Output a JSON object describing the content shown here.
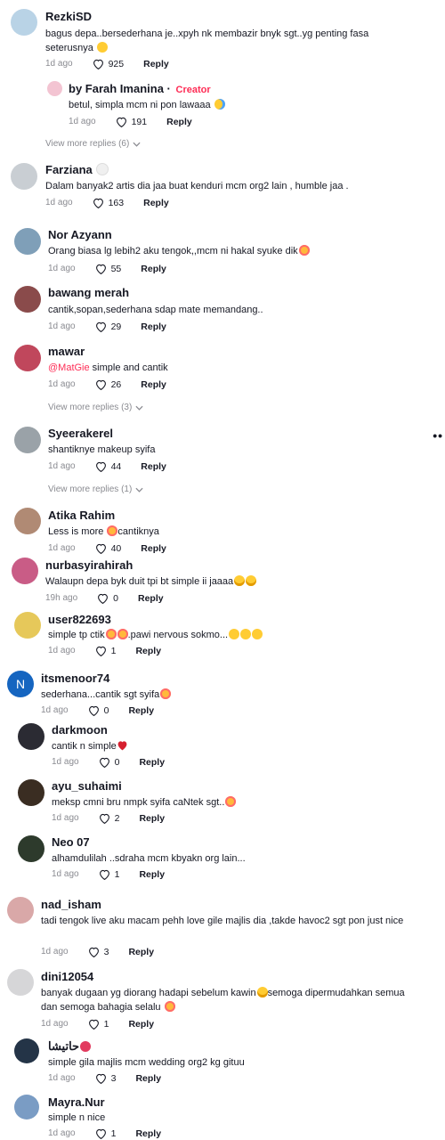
{
  "comments": [
    {
      "user": "RezkiSD",
      "text": "bagus depa..bersederhana je..xpyh nk membazir bnyk sgt..yg penting fasa seterusnya",
      "emoji": "smile",
      "time": "1d ago",
      "likes": "925",
      "reply": "Reply",
      "avatar_color": "#b9d3e6"
    },
    {
      "user": "by Farah Imanina",
      "creator_sep": "·",
      "creator": "Creator",
      "text": "betul, simpla mcm ni pon lawaaa",
      "emoji": "cry",
      "time": "1d ago",
      "likes": "191",
      "reply": "Reply",
      "avatar_color": "#f3c4d2"
    },
    {
      "view_more": "View more replies (6)"
    },
    {
      "user": "Farziana",
      "user_emoji": "white-heart",
      "text": "Dalam banyak2 artis dia jaa buat kenduri mcm org2 lain , humble jaa .",
      "time": "1d ago",
      "likes": "163",
      "reply": "Reply",
      "avatar_color": "#c9ced3"
    },
    {
      "user": "Nor Azyann",
      "text": "Orang biasa lg lebih2 aku tengok,,mcm ni hakal syuke dik",
      "emoji": "love",
      "time": "1d ago",
      "likes": "55",
      "reply": "Reply",
      "avatar_color": "#7f9fb8"
    },
    {
      "user": "bawang merah",
      "text": "cantik,sopan,sederhana sdap mate memandang..",
      "time": "1d ago",
      "likes": "29",
      "reply": "Reply",
      "avatar_color": "#8a4b4b"
    },
    {
      "user": "mawar",
      "mention": "@MatGie",
      "text": " simple and cantik",
      "time": "1d ago",
      "likes": "26",
      "reply": "Reply",
      "avatar_color": "#c0475c"
    },
    {
      "view_more": "View more replies (3)"
    },
    {
      "user": "Syeerakerel",
      "text": "shantiknye makeup syifa",
      "time": "1d ago",
      "likes": "44",
      "reply": "Reply",
      "avatar_color": "#9aa2a8"
    },
    {
      "view_more": "View more replies (1)"
    },
    {
      "user": "Atika Rahim",
      "text": "Less is more ",
      "text2": "cantiknya",
      "emoji": "love",
      "time": "1d ago",
      "likes": "40",
      "reply": "Reply",
      "avatar_color": "#b08a74"
    },
    {
      "user": "nurbasyirahirah",
      "text": "Walaupn depa byk duit tpi bt simple ii jaaaa",
      "emoji": "sad",
      "emoji_count": 2,
      "time": "19h ago",
      "likes": "0",
      "reply": "Reply",
      "avatar_color": "#c95c86"
    },
    {
      "user": "user822693",
      "text": "simple tp ctik",
      "text2": ".pawi nervous sokmo...",
      "emoji": "love",
      "time": "1d ago",
      "likes": "1",
      "reply": "Reply",
      "avatar_color": "#e6c85a"
    },
    {
      "user": "itsmenoor74",
      "avatar_letter": "N",
      "text": "sederhana...cantik sgt syifa",
      "emoji": "love",
      "time": "1d ago",
      "likes": "0",
      "reply": "Reply",
      "avatar_color": "#1565c0"
    },
    {
      "user": "darkmoon",
      "text": "cantik n simple",
      "emoji": "heart",
      "time": "1d ago",
      "likes": "0",
      "reply": "Reply",
      "avatar_color": "#2b2b33"
    },
    {
      "user": "ayu_suhaimi",
      "text": "meksp cmni bru nmpk syifa caNtek sgt..",
      "emoji": "love",
      "time": "1d ago",
      "likes": "2",
      "reply": "Reply",
      "avatar_color": "#3a2d22"
    },
    {
      "user": "Neo 07",
      "text": "alhamdulilah ..sdraha mcm kbyakn org lain...",
      "time": "1d ago",
      "likes": "1",
      "reply": "Reply",
      "avatar_color": "#2d3a2c"
    },
    {
      "user": "nad_isham",
      "text": "tadi tengok live aku macam pehh love gile majlis dia ,takde havoc2 sgt pon just nice",
      "time": "1d ago",
      "likes": "3",
      "reply": "Reply",
      "avatar_color": "#d9a8a8"
    },
    {
      "user": "dini12054",
      "text": "banyak dugaan yg diorang hadapi sebelum kawin",
      "text2": "semoga dipermudahkan semua dan semoga bahagia selalu",
      "emoji": "sad",
      "time": "1d ago",
      "likes": "1",
      "reply": "Reply",
      "avatar_color": "#d6d6d8"
    },
    {
      "user": "حاتيشا",
      "user_emoji": "flower",
      "text": "simple gila majlis mcm wedding org2 kg gituu",
      "time": "1d ago",
      "likes": "3",
      "reply": "Reply",
      "avatar_color": "#243447"
    },
    {
      "user": "Mayra.Nur",
      "text": "simple n nice",
      "time": "1d ago",
      "likes": "1",
      "reply": "Reply",
      "avatar_color": "#7a9cc4"
    }
  ],
  "icons": {
    "heart": "heart-outline-icon",
    "chevron": "chevron-down-icon",
    "more": "more-options-icon"
  },
  "more_label": "••"
}
